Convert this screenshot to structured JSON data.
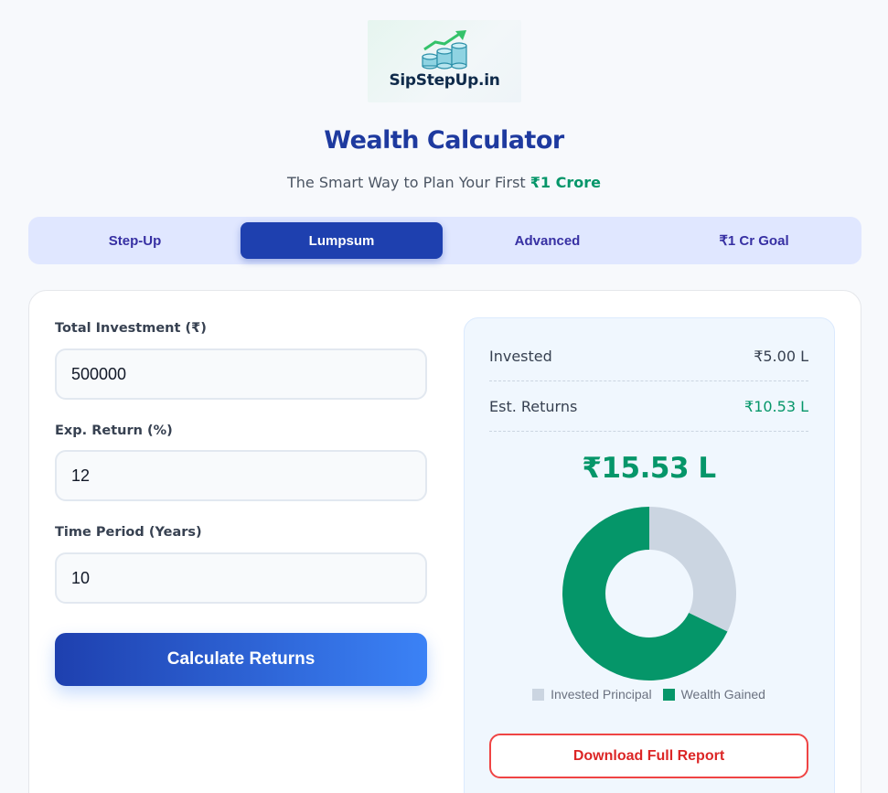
{
  "brand": {
    "logo_text": "SipStepUp.in"
  },
  "header": {
    "title": "Wealth Calculator",
    "subtitle_prefix": "The Smart Way to Plan Your First ",
    "subtitle_highlight": "₹1 Crore"
  },
  "tabs": [
    {
      "label": "Step-Up",
      "active": false
    },
    {
      "label": "Lumpsum",
      "active": true
    },
    {
      "label": "Advanced",
      "active": false
    },
    {
      "label": "₹1 Cr Goal",
      "active": false
    }
  ],
  "form": {
    "investment": {
      "label": "Total Investment (₹)",
      "value": "500000"
    },
    "return_rate": {
      "label": "Exp. Return (%)",
      "value": "12"
    },
    "period": {
      "label": "Time Period (Years)",
      "value": "10"
    },
    "submit_label": "Calculate Returns"
  },
  "results": {
    "invested_label": "Invested",
    "invested_value": "₹5.00 L",
    "returns_label": "Est. Returns",
    "returns_value": "₹10.53 L",
    "total_value": "₹15.53 L",
    "download_label": "Download Full Report"
  },
  "chart_data": {
    "type": "pie",
    "categories": [
      "Invested Principal",
      "Wealth Gained"
    ],
    "values": [
      5.0,
      10.53
    ],
    "colors": [
      "#cbd5e1",
      "#059669"
    ],
    "legend": "bottom"
  },
  "colors": {
    "primary": "#1e40af",
    "accent_green": "#059669",
    "danger": "#dc2626"
  }
}
